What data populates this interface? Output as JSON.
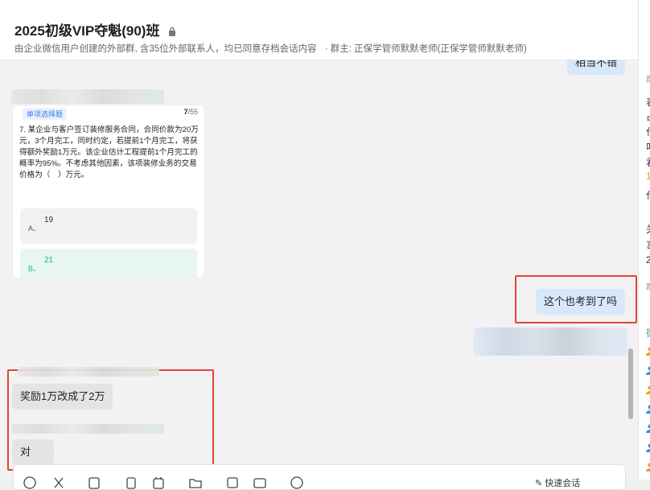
{
  "header": {
    "title": "2025初级VIP夺魁(90)班",
    "subtitle": "由企业微信用户创建的外部群, 含35位外部联系人，均已同意存档会话内容",
    "owner": "· 群主: 正保学管师默默老师(正保学管师默默老师)"
  },
  "messages": {
    "top_partial": "相当不错",
    "quiz": {
      "tag": "单项选择题",
      "progress_current": "7",
      "progress_total": "/55",
      "question": "7. 某企业与客户签订装修服务合同，合同价款为20万元，3个月完工，同时约定，若提前1个月完工，将获得额外奖励1万元。该企业估计工程提前1个月完工的概率为95%。不考虑其他因素，该项装修业务的交易价格为（　）万元。",
      "option_a_key": "A、",
      "option_a_value": "19",
      "option_b_key": "B、",
      "option_b_value": "21"
    },
    "out_1": "这个也考到了吗",
    "in_1": "奖励1万改成了2万",
    "in_2": "对"
  },
  "right_panel": {
    "chars": [
      "群",
      "表",
      "占",
      "代",
      "叫",
      "君",
      "1",
      "代",
      "关",
      "言",
      "2",
      "群",
      "德"
    ]
  },
  "toolbar": {
    "quick_reply": "快速会话"
  },
  "colors": {
    "highlight_border": "#e0443a",
    "out_bubble": "#d6e8f9",
    "in_bubble": "#e4e4e4",
    "option_correct": "#27b07a"
  }
}
